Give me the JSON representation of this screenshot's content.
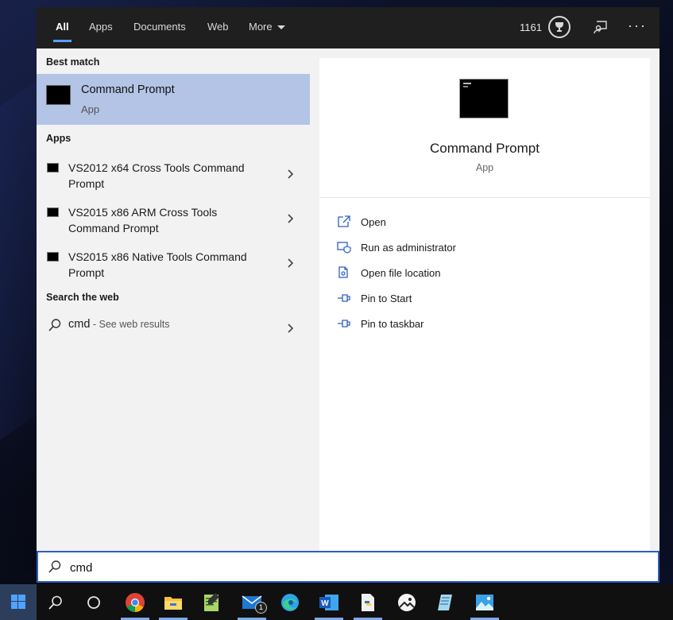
{
  "tabs": [
    {
      "label": "All"
    },
    {
      "label": "Apps"
    },
    {
      "label": "Documents"
    },
    {
      "label": "Web"
    },
    {
      "label": "More"
    }
  ],
  "topbar": {
    "points": "1161"
  },
  "results": {
    "best_match_header": "Best match",
    "best_match": {
      "title": "Command Prompt",
      "subtitle": "App"
    },
    "apps_header": "Apps",
    "apps": [
      {
        "label": "VS2012 x64 Cross Tools Command Prompt"
      },
      {
        "label": "VS2015 x86 ARM Cross Tools Command Prompt"
      },
      {
        "label": "VS2015 x86 Native Tools Command Prompt"
      }
    ],
    "web_header": "Search the web",
    "web": {
      "query": "cmd",
      "hint": " - See web results"
    }
  },
  "details": {
    "title": "Command Prompt",
    "subtitle": "App",
    "actions": [
      {
        "label": "Open",
        "icon": "open-icon"
      },
      {
        "label": "Run as administrator",
        "icon": "shield-icon"
      },
      {
        "label": "Open file location",
        "icon": "file-location-icon"
      },
      {
        "label": "Pin to Start",
        "icon": "pin-icon"
      },
      {
        "label": "Pin to taskbar",
        "icon": "pin-icon"
      }
    ]
  },
  "search": {
    "value": "cmd"
  },
  "taskbar": {
    "apps": [
      "start",
      "search",
      "cortana",
      "chrome",
      "file-explorer",
      "notepad-plus",
      "mail",
      "edge",
      "word",
      "python",
      "photos-app",
      "notepad",
      "photos"
    ],
    "mail_badge": "1"
  },
  "colors": {
    "accent": "#2e5fbf",
    "selection": "#b4c4e6",
    "topbar": "#1f1f1f"
  }
}
